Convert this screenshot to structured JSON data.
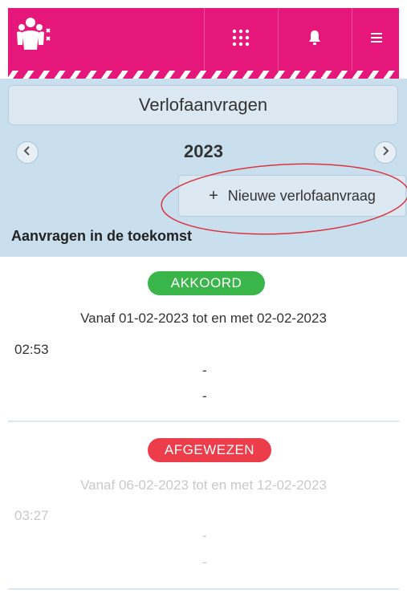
{
  "header": {
    "logo_icon": "people-logo-icon",
    "apps_icon": "grid-icon",
    "bell_icon": "bell-icon",
    "menu_icon": "hamburger-icon",
    "accent_color": "#e6177a"
  },
  "page": {
    "title": "Verlofaanvragen",
    "year": "2023",
    "new_request_label": "Nieuwe verlofaanvraag",
    "new_request_icon": "+",
    "section_heading": "Aanvragen in de toekomst"
  },
  "requests": [
    {
      "status": "AKKOORD",
      "status_color": "#39b54a",
      "period": "Vanaf 01-02-2023 tot en met 02-02-2023",
      "time": "02:53",
      "line1": "-",
      "line2": "-"
    },
    {
      "status": "AFGEWEZEN",
      "status_color": "#ee3d4a",
      "period": "Vanaf 06-02-2023 tot en met 12-02-2023",
      "time": "03:27",
      "line1": "-",
      "line2": "-"
    }
  ]
}
